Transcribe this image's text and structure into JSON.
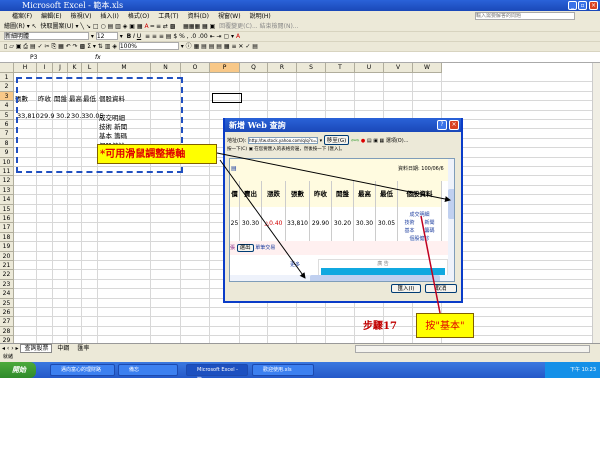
{
  "window": {
    "title": "Microsoft Excel - 範本.xls"
  },
  "menu": [
    "檔案(F)",
    "編輯(E)",
    "檢視(V)",
    "插入(I)",
    "格式(O)",
    "工具(T)",
    "資料(D)",
    "視窗(W)",
    "說明(H)"
  ],
  "help_box_placeholder": "輸入需要解答的問題",
  "toolbar": {
    "draw_label": "繪圖(R)",
    "autoshape_label": "快取圖案(U)",
    "reply_label": "回覆變更(C)... 結束檢閱(N)...",
    "font": "新細明體",
    "font_size": "12",
    "zoom": "100%"
  },
  "formula_bar": {
    "name_box": "P3",
    "fx": "fx"
  },
  "columns": [
    "H",
    "I",
    "J",
    "K",
    "L",
    "M",
    "N",
    "O",
    "P",
    "Q",
    "R",
    "S",
    "T",
    "U",
    "V",
    "W"
  ],
  "rows": [
    "1",
    "2",
    "3",
    "4",
    "5",
    "6",
    "7",
    "8",
    "9",
    "10",
    "11",
    "12",
    "13",
    "14",
    "15",
    "16",
    "17",
    "18",
    "19",
    "20",
    "21",
    "22",
    "23",
    "24",
    "25",
    "26",
    "27",
    "28",
    "29"
  ],
  "cells": {
    "headers": [
      "張數",
      "昨收",
      "開盤",
      "最高",
      "最低",
      "個股資料"
    ],
    "values": [
      "33,810",
      "29.9",
      "30.2",
      "30.3",
      "30.05",
      "成交明細"
    ],
    "m6": "技術 新聞",
    "m7": "基本 籌碼",
    "m8": "個股健診"
  },
  "callout_scroll": "*可用滑鼠調整捲軸",
  "step_label": "步驟17",
  "callout_basic": "按\"基本\"",
  "dialog": {
    "title": "新增 Web 查詢",
    "address_label": "地址(D):",
    "address_value": "http://tw.stock.yahoo.com/q/q?s=2002",
    "go_label": "移至(G)",
    "options_label": "選項(O)...",
    "hint": "按一下(C) ▣ 在您要匯入的表格旁邊，然後按一下 [匯入]。",
    "date_label": "資料日期: 100/06/6",
    "table_headers": [
      "價",
      "賣出",
      "漲跌",
      "張數",
      "昨收",
      "開盤",
      "最高",
      "最低",
      "個股資料"
    ],
    "table_values": [
      "25",
      "30.30",
      "△0.40",
      "33,810",
      "29.90",
      "30.20",
      "30.30",
      "30.05"
    ],
    "stock_links": [
      "成交明細",
      "技術",
      "新聞",
      "基本",
      "籌碼",
      "個股健診"
    ],
    "row_extra": [
      "張",
      "選出",
      "單筆交易"
    ],
    "more_label": "更多",
    "notice_label": "廣 告",
    "import_button": "匯入(I)",
    "cancel_button": "取消"
  },
  "sheet_tabs": [
    "查詢股票",
    "中鋼",
    "匯率"
  ],
  "status": "就緒",
  "taskbar": {
    "start": "開始",
    "items": [
      "邁向富心的理財路",
      "備忘",
      "Microsoft Excel - 範...",
      "歡迎使用.xls"
    ],
    "clock": "下午 10:23"
  },
  "colors": {
    "accent_blue": "#1a48b8",
    "callout_yellow": "#ffff00",
    "callout_text": "#e00000",
    "dash": "#2050c0"
  }
}
